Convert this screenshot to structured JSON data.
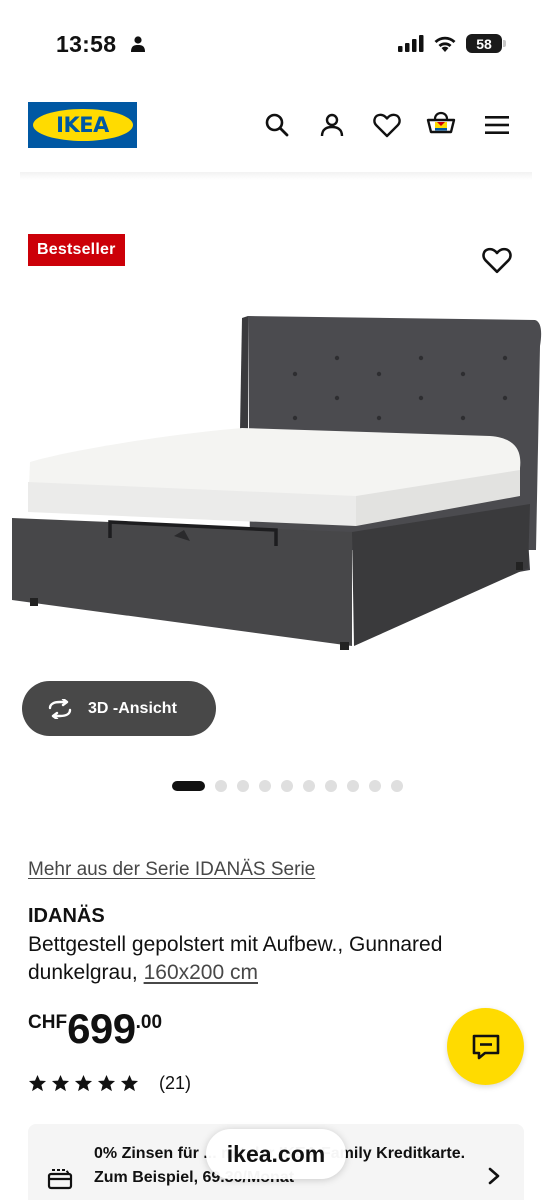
{
  "status_bar": {
    "time": "13:58",
    "battery": "58"
  },
  "header": {
    "logo_text": "IKEA",
    "icons": [
      "search-icon",
      "account-icon",
      "wishlist-icon",
      "cart-icon",
      "menu-icon"
    ]
  },
  "product_media": {
    "badge": "Bestseller",
    "view_3d_label": "3D -Ansicht",
    "carousel": {
      "total": 10,
      "active_index": 0
    }
  },
  "product": {
    "series_link": "Mehr aus der Serie IDANÄS Serie",
    "name": "IDANÄS",
    "description": "Bettgestell gepolstert mit Aufbew., Gunnared dunkelgrau, ",
    "size_link": "160x200 cm",
    "price": {
      "currency": "CHF",
      "integer": "699",
      "decimals": ".00"
    },
    "rating": {
      "stars": 5,
      "count": "(21)"
    }
  },
  "financing": {
    "text": "0% Zinsen für ... mit der IKEA Family Kreditkarte. Zum Beispiel, 69.30/Monat"
  },
  "browser": {
    "url": "ikea.com"
  },
  "colors": {
    "ikea_blue": "#0058a3",
    "ikea_yellow": "#ffdb00",
    "badge_red": "#cc0008",
    "dark_button": "#484848"
  }
}
